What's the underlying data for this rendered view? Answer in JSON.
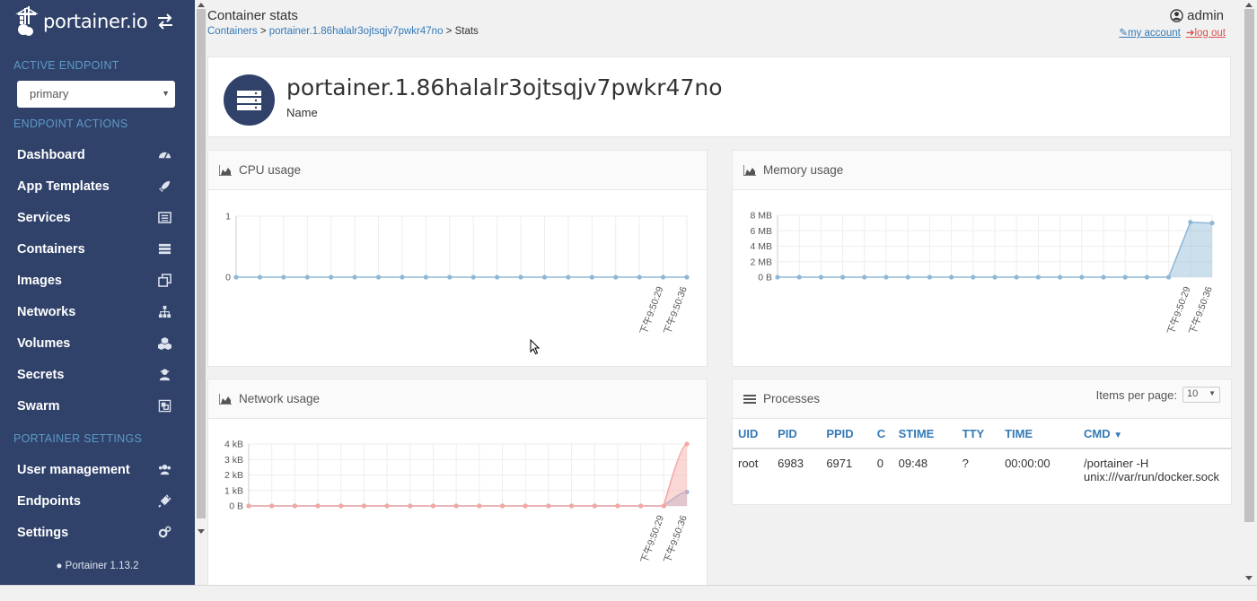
{
  "brand": {
    "name": "portainer.io"
  },
  "sidebar": {
    "active_endpoint_title": "ACTIVE ENDPOINT",
    "endpoint_selected": "primary",
    "endpoint_actions_title": "ENDPOINT ACTIONS",
    "items": [
      {
        "label": "Dashboard",
        "icon": "dashboard-icon"
      },
      {
        "label": "App Templates",
        "icon": "rocket-icon"
      },
      {
        "label": "Services",
        "icon": "list-alt-icon"
      },
      {
        "label": "Containers",
        "icon": "server-icon"
      },
      {
        "label": "Images",
        "icon": "clone-icon"
      },
      {
        "label": "Networks",
        "icon": "sitemap-icon"
      },
      {
        "label": "Volumes",
        "icon": "cubes-icon"
      },
      {
        "label": "Secrets",
        "icon": "user-secret-icon"
      },
      {
        "label": "Swarm",
        "icon": "object-group-icon"
      }
    ],
    "portainer_settings_title": "PORTAINER SETTINGS",
    "settings_items": [
      {
        "label": "User management",
        "icon": "users-icon"
      },
      {
        "label": "Endpoints",
        "icon": "plug-icon"
      },
      {
        "label": "Settings",
        "icon": "cogs-icon"
      }
    ],
    "footer": "Portainer 1.13.2"
  },
  "header": {
    "title": "Container stats",
    "breadcrumb": [
      {
        "label": "Containers",
        "link": true
      },
      {
        "label": ">",
        "link": false
      },
      {
        "label": "portainer.1.86halalr3ojtsqjv7pwkr47no",
        "link": true
      },
      {
        "label": "> Stats",
        "link": false
      }
    ],
    "user": "admin",
    "my_account": "my account",
    "log_out": "log out"
  },
  "container": {
    "name": "portainer.1.86halalr3ojtsqjv7pwkr47no",
    "label": "Name"
  },
  "panels": {
    "cpu_title": "CPU usage",
    "memory_title": "Memory usage",
    "network_title": "Network usage",
    "processes_title": "Processes",
    "items_per_page_label": "Items per page:",
    "items_per_page_value": "10"
  },
  "chart_data": [
    {
      "type": "line",
      "title": "CPU usage",
      "y_ticks": [
        "0",
        "1"
      ],
      "ylim": [
        0,
        1
      ],
      "x_labels": [
        "下午9:50:29",
        "下午9:50:36"
      ],
      "series": [
        {
          "values": [
            0,
            0,
            0,
            0,
            0,
            0,
            0,
            0,
            0,
            0,
            0,
            0,
            0,
            0,
            0,
            0,
            0,
            0,
            0,
            0
          ]
        }
      ],
      "grid": true,
      "color": "#8fb8d6"
    },
    {
      "type": "area",
      "title": "Memory usage",
      "y_ticks": [
        "0 B",
        "2 MB",
        "4 MB",
        "6 MB",
        "8 MB"
      ],
      "ylim": [
        0,
        8
      ],
      "x_labels": [
        "下午9:50:29",
        "下午9:50:36"
      ],
      "series": [
        {
          "values": [
            0,
            0,
            0,
            0,
            0,
            0,
            0,
            0,
            0,
            0,
            0,
            0,
            0,
            0,
            0,
            0,
            0,
            0,
            0,
            7.1,
            7.0
          ]
        }
      ],
      "grid": true,
      "color": "#8fb8d6"
    },
    {
      "type": "area",
      "title": "Network usage",
      "y_ticks": [
        "0 B",
        "1 kB",
        "2 kB",
        "3 kB",
        "4 kB"
      ],
      "ylim": [
        0,
        4
      ],
      "x_labels": [
        "下午9:50:29",
        "下午9:50:36"
      ],
      "series": [
        {
          "values": [
            0,
            0,
            0,
            0,
            0,
            0,
            0,
            0,
            0,
            0,
            0,
            0,
            0,
            0,
            0,
            0,
            0,
            0,
            0,
            0.9
          ],
          "color": "#9fb8dc"
        },
        {
          "values": [
            0,
            0,
            0,
            0,
            0,
            0,
            0,
            0,
            0,
            0,
            0,
            0,
            0,
            0,
            0,
            0,
            0,
            0,
            0,
            4.0
          ],
          "color": "#f4a8a4"
        }
      ],
      "grid": true
    }
  ],
  "processes": {
    "columns": [
      "UID",
      "PID",
      "PPID",
      "C",
      "STIME",
      "TTY",
      "TIME",
      "CMD"
    ],
    "rows": [
      [
        "root",
        "6983",
        "6971",
        "0",
        "09:48",
        "?",
        "00:00:00",
        "/portainer -H unix:///var/run/docker.sock"
      ]
    ]
  },
  "colors": {
    "sidebar_bg": "#30426a",
    "section_title": "#5c9ac8",
    "link": "#337ab7",
    "logout": "#d9534f"
  }
}
